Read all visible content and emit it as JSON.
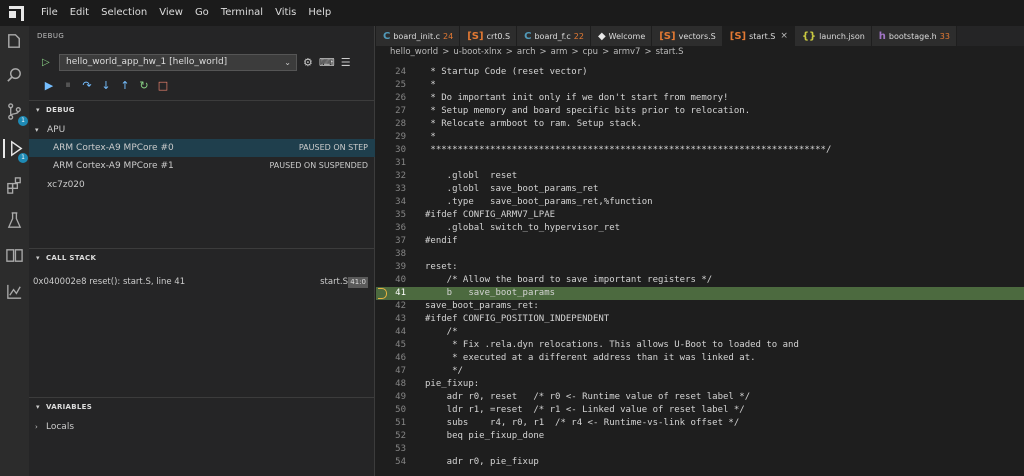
{
  "menu": [
    "File",
    "Edit",
    "Selection",
    "View",
    "Go",
    "Terminal",
    "Vitis",
    "Help"
  ],
  "activity_badges": {
    "scm": "1",
    "debug": "1"
  },
  "sidebar": {
    "title": "DEBUG",
    "launch_config": "hello_world_app_hw_1 [hello_world]",
    "debug_section": "DEBUG",
    "tree": [
      {
        "label": "APU",
        "state": ""
      },
      {
        "label": "ARM Cortex-A9 MPCore #0",
        "state": "PAUSED ON STEP"
      },
      {
        "label": "ARM Cortex-A9 MPCore #1",
        "state": "PAUSED ON SUSPENDED"
      },
      {
        "label": "xc7z020",
        "state": ""
      }
    ],
    "call_stack_title": "CALL STACK",
    "call_stack": {
      "frame": "0x040002e8 reset(): start.S, line 41",
      "file": "start.S",
      "pos": "41:0"
    },
    "variables_title": "VARIABLES",
    "locals_label": "Locals"
  },
  "tabs": [
    {
      "icon": "C",
      "color": "#519aba",
      "name": "board_init.c",
      "count": "24"
    },
    {
      "icon": "[S]",
      "color": "#e37933",
      "name": "crt0.S",
      "count": ""
    },
    {
      "icon": "C",
      "color": "#519aba",
      "name": "board_f.c",
      "count": "22"
    },
    {
      "icon": "◆",
      "color": "#e8e8e8",
      "name": "Welcome",
      "count": ""
    },
    {
      "icon": "[S]",
      "color": "#e37933",
      "name": "vectors.S",
      "count": ""
    },
    {
      "icon": "[S]",
      "color": "#e37933",
      "name": "start.S",
      "count": ""
    },
    {
      "icon": "{}",
      "color": "#cbcb41",
      "name": "launch.json",
      "count": ""
    },
    {
      "icon": "h",
      "color": "#a074c4",
      "name": "bootstage.h",
      "count": "33"
    }
  ],
  "breadcrumbs": [
    "hello_world",
    ">",
    "u-boot-xlnx",
    ">",
    "arch",
    ">",
    "arm",
    ">",
    "cpu",
    ">",
    "armv7",
    ">",
    "start.S"
  ],
  "code": [
    {
      "n": "24",
      "t": " * Startup Code (reset vector)"
    },
    {
      "n": "25",
      "t": " *"
    },
    {
      "n": "26",
      "t": " * Do important init only if we don't start from memory!"
    },
    {
      "n": "27",
      "t": " * Setup memory and board specific bits prior to relocation."
    },
    {
      "n": "28",
      "t": " * Relocate armboot to ram. Setup stack."
    },
    {
      "n": "29",
      "t": " *"
    },
    {
      "n": "30",
      "t": " *************************************************************************/"
    },
    {
      "n": "31",
      "t": ""
    },
    {
      "n": "32",
      "t": "    .globl  reset"
    },
    {
      "n": "33",
      "t": "    .globl  save_boot_params_ret"
    },
    {
      "n": "34",
      "t": "    .type   save_boot_params_ret,%function"
    },
    {
      "n": "35",
      "t": "#ifdef CONFIG_ARMV7_LPAE"
    },
    {
      "n": "36",
      "t": "    .global switch_to_hypervisor_ret"
    },
    {
      "n": "37",
      "t": "#endif"
    },
    {
      "n": "38",
      "t": ""
    },
    {
      "n": "39",
      "t": "reset:"
    },
    {
      "n": "40",
      "t": "    /* Allow the board to save important registers */"
    },
    {
      "n": "41",
      "t": "    b   save_boot_params"
    },
    {
      "n": "42",
      "t": "save_boot_params_ret:"
    },
    {
      "n": "43",
      "t": "#ifdef CONFIG_POSITION_INDEPENDENT"
    },
    {
      "n": "44",
      "t": "    /*"
    },
    {
      "n": "45",
      "t": "     * Fix .rela.dyn relocations. This allows U-Boot to loaded to and"
    },
    {
      "n": "46",
      "t": "     * executed at a different address than it was linked at."
    },
    {
      "n": "47",
      "t": "     */"
    },
    {
      "n": "48",
      "t": "pie_fixup:"
    },
    {
      "n": "49",
      "t": "    adr r0, reset   /* r0 <- Runtime value of reset label */"
    },
    {
      "n": "50",
      "t": "    ldr r1, =reset  /* r1 <- Linked value of reset label */"
    },
    {
      "n": "51",
      "t": "    subs    r4, r0, r1  /* r4 <- Runtime-vs-link offset */"
    },
    {
      "n": "52",
      "t": "    beq pie_fixup_done"
    },
    {
      "n": "53",
      "t": ""
    },
    {
      "n": "54",
      "t": "    adr r0, pie_fixup"
    }
  ],
  "current_line": "41"
}
